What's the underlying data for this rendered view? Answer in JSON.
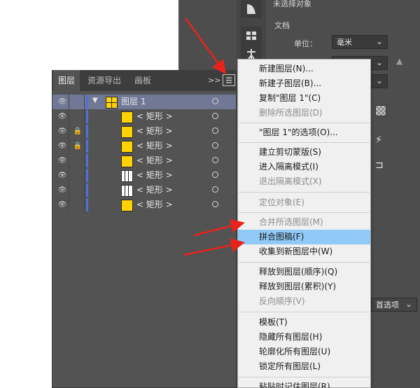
{
  "properties_panel": {
    "no_selection": "未选择对象",
    "document_label": "文档",
    "unit_label": "单位：",
    "unit_value": "毫米",
    "prefs_button": "首选项"
  },
  "layers_panel": {
    "tabs": [
      "图层",
      "资源导出",
      "画板"
    ],
    "active_tab": 0,
    "overflow_icon": ">>",
    "rows": [
      {
        "name": "图层 1",
        "type": "layer",
        "locked": false,
        "thumb": "layer"
      },
      {
        "name": "< 矩形 >",
        "type": "path",
        "locked": false,
        "thumb": "yellow"
      },
      {
        "name": "< 矩形 >",
        "type": "path",
        "locked": true,
        "thumb": "yellow"
      },
      {
        "name": "< 矩形 >",
        "type": "path",
        "locked": true,
        "thumb": "yellow"
      },
      {
        "name": "< 矩形 >",
        "type": "path",
        "locked": false,
        "thumb": "yellow"
      },
      {
        "name": "< 矩形 >",
        "type": "path",
        "locked": false,
        "thumb": "white-striped"
      },
      {
        "name": "< 矩形 >",
        "type": "path",
        "locked": false,
        "thumb": "white-striped"
      },
      {
        "name": "< 矩形 >",
        "type": "path",
        "locked": false,
        "thumb": "yellow"
      }
    ]
  },
  "context_menu": {
    "items": [
      {
        "label": "新建图层(N)...",
        "disabled": false
      },
      {
        "label": "新建子图层(B)...",
        "disabled": false
      },
      {
        "label": "复制\"图层 1\"(C)",
        "disabled": false
      },
      {
        "label": "删除所选图层(D)",
        "disabled": true
      },
      {
        "label": "\"图层 1\"的选项(O)...",
        "disabled": false
      },
      {
        "label": "建立剪切蒙版(S)",
        "disabled": false
      },
      {
        "label": "进入隔离模式(I)",
        "disabled": false
      },
      {
        "label": "退出隔离模式(X)",
        "disabled": true
      },
      {
        "label": "定位对象(E)",
        "disabled": true
      },
      {
        "label": "合并所选图层(M)",
        "disabled": true
      },
      {
        "label": "拼合图稿(F)",
        "disabled": false,
        "highlighted": true
      },
      {
        "label": "收集到新图层中(W)",
        "disabled": false
      },
      {
        "label": "释放到图层(顺序)(Q)",
        "disabled": false
      },
      {
        "label": "释放到图层(累积)(Y)",
        "disabled": false
      },
      {
        "label": "反向顺序(V)",
        "disabled": true
      },
      {
        "label": "模板(T)",
        "disabled": false
      },
      {
        "label": "隐藏所有图层(H)",
        "disabled": false
      },
      {
        "label": "轮廓化所有图层(U)",
        "disabled": false
      },
      {
        "label": "锁定所有图层(L)",
        "disabled": false
      },
      {
        "label": "粘贴时记住图层(R)",
        "disabled": false
      }
    ]
  },
  "colors": {
    "annotation_arrow": "#e8231c",
    "menu_highlight": "#91c9f7",
    "layer_color": "#4b73d9",
    "thumb_yellow": "#ffd200"
  }
}
